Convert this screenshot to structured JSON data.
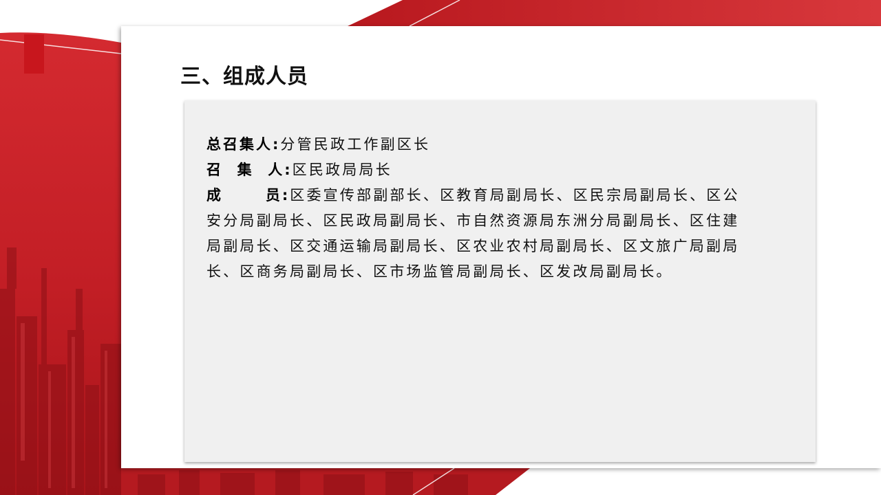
{
  "slide": {
    "title": "三、组成人员",
    "colors": {
      "accent_red": "#c8161d",
      "panel_bg": "#ffffff",
      "box_bg": "#f0f0f0"
    }
  },
  "members": {
    "lead_convener_label": "总召集人:",
    "lead_convener_value": "分管民政工作副区长",
    "convener_label": "召  集  人:",
    "convener_value": "区民政局局长",
    "member_label": "成      员:",
    "member_value": "区委宣传部副部长、区教育局副局长、区民宗局副局长、区公安分局副局长、区民政局副局长、市自然资源局东洲分局副局长、区住建局副局长、区交通运输局副局长、区农业农村局副局长、区文旅广局副局长、区商务局副局长、区市场监管局副局长、区发改局副局长。"
  }
}
